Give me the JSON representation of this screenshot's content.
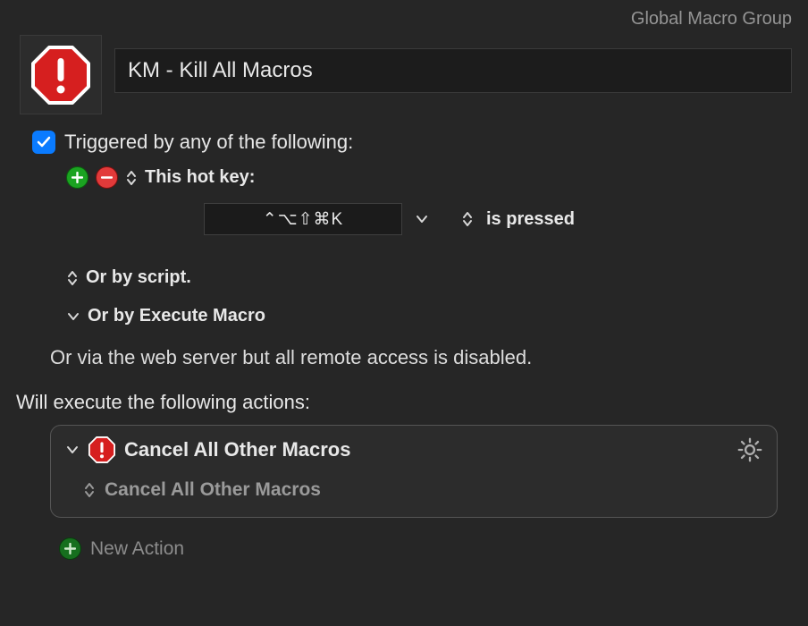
{
  "header": {
    "group_label": "Global Macro Group"
  },
  "macro": {
    "name": "KM - Kill All Macros"
  },
  "triggers": {
    "enabled_label": "Triggered by any of the following:",
    "hotkey_label": "This hot key:",
    "hotkey_value": "⌃⌥⇧⌘K",
    "hotkey_state": "is pressed",
    "script_label": "Or by script.",
    "execute_macro_label": "Or by Execute Macro",
    "webserver_label": "Or via the web server but all remote access is disabled."
  },
  "actions": {
    "heading": "Will execute the following actions:",
    "items": [
      {
        "title": "Cancel All Other Macros",
        "subtitle": "Cancel All Other Macros"
      }
    ],
    "new_action_label": "New Action"
  }
}
